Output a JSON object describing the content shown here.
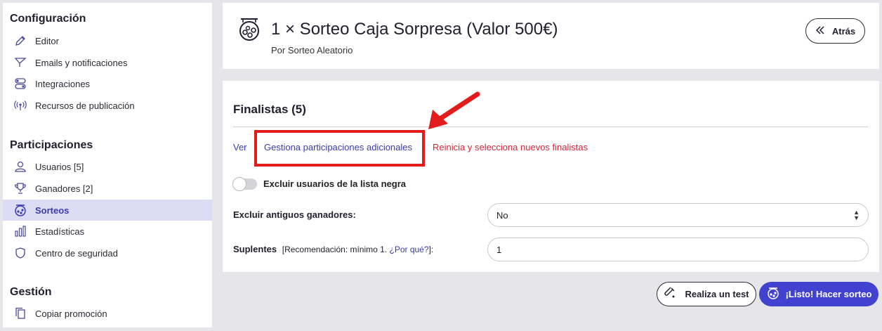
{
  "sidebar": {
    "sections": [
      {
        "title": "Configuración",
        "items": [
          {
            "label": "Editor",
            "icon": "pencil-icon"
          },
          {
            "label": "Emails y notificaciones",
            "icon": "send-icon"
          },
          {
            "label": "Integraciones",
            "icon": "toggles-icon"
          },
          {
            "label": "Recursos de publicación",
            "icon": "broadcast-icon"
          }
        ]
      },
      {
        "title": "Participaciones",
        "items": [
          {
            "label": "Usuarios [5]",
            "icon": "user-icon"
          },
          {
            "label": "Ganadores [2]",
            "icon": "trophy-icon"
          },
          {
            "label": "Sorteos",
            "icon": "lottery-drum-icon",
            "active": true
          },
          {
            "label": "Estadísticas",
            "icon": "bar-chart-icon"
          },
          {
            "label": "Centro de seguridad",
            "icon": "shield-icon"
          }
        ]
      },
      {
        "title": "Gestión",
        "items": [
          {
            "label": "Copiar promoción",
            "icon": "copy-icon"
          }
        ]
      }
    ]
  },
  "header": {
    "title": "1 × Sorteo Caja Sorpresa (Valor 500€)",
    "subtitle": "Por Sorteo Aleatorio",
    "back_label": "Atrás"
  },
  "finalists": {
    "heading": "Finalistas (5)",
    "links": {
      "view": "Ver",
      "manage": "Gestiona participaciones adicionales",
      "reset": "Reinicia y selecciona nuevos finalistas"
    },
    "blacklist_toggle_label": "Excluir usuarios de la lista negra",
    "exclude_label": "Excluir antiguos ganadores:",
    "exclude_value": "No",
    "substitutes_label": "Suplentes",
    "substitutes_note_prefix": "[Recomendación: mínimo 1. ",
    "substitutes_note_link": "¿Por qué?",
    "substitutes_note_suffix": "]:",
    "substitutes_value": "1"
  },
  "actions": {
    "test_label": "Realiza un test",
    "draw_label": "¡Listo! Hacer sorteo"
  },
  "colors": {
    "accent": "#4142d0",
    "link": "#3b3bb0",
    "danger_link": "#d6253a",
    "annotation_red": "#e31b1b",
    "active_bg": "#dcdcf5"
  }
}
